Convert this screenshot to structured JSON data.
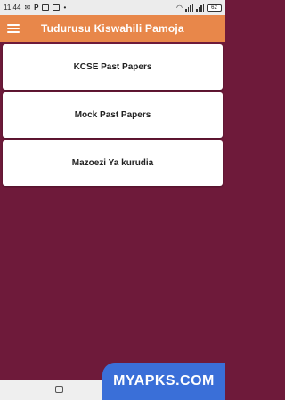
{
  "status_bar": {
    "time": "11:44",
    "left_icons": [
      "mail-icon",
      "parking-icon",
      "message-icon",
      "app-icon",
      "dot-icon"
    ],
    "right_icons": [
      "wifi-icon",
      "signal-icon",
      "signal-icon-2"
    ],
    "battery": "62"
  },
  "app_bar": {
    "title": "Tudurusu Kiswahili Pamoja",
    "menu_icon": "hamburger-menu-icon",
    "background": "#e8874a"
  },
  "menu_cards": [
    {
      "label": "KCSE Past Papers"
    },
    {
      "label": "Mock Past Papers"
    },
    {
      "label": "Mazoezi Ya kurudia"
    }
  ],
  "page_background": "#6e1a3a",
  "watermark": {
    "text": "MYAPKS.COM",
    "color": "#3a6fd8"
  }
}
